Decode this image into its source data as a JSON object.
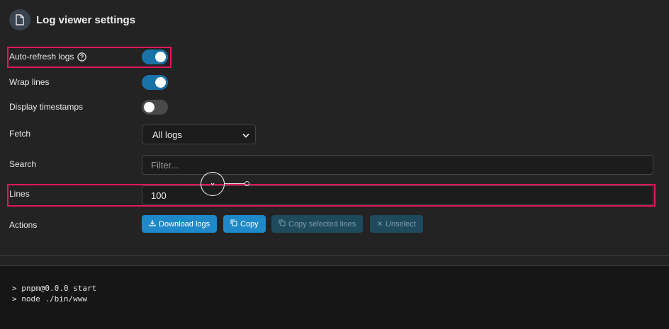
{
  "header": {
    "title": "Log viewer settings",
    "icon": "document-icon"
  },
  "settings": {
    "auto_refresh": {
      "label": "Auto-refresh logs",
      "enabled": true
    },
    "wrap_lines": {
      "label": "Wrap lines",
      "enabled": true
    },
    "display_timestamps": {
      "label": "Display timestamps",
      "enabled": false
    },
    "fetch": {
      "label": "Fetch",
      "selected": "All logs"
    },
    "search": {
      "label": "Search",
      "placeholder": "Filter...",
      "value": ""
    },
    "lines": {
      "label": "Lines",
      "value": "100"
    },
    "actions": {
      "label": "Actions",
      "download": "Download logs",
      "copy": "Copy",
      "copy_selected": "Copy selected lines",
      "unselect": "Unselect"
    }
  },
  "console": {
    "lines": [
      "> pnpm@0.0.0 start",
      "> node ./bin/www"
    ]
  },
  "colors": {
    "toggle_on": "#1a73a8",
    "primary_button": "#1e88c9",
    "disabled_button": "#1f4a5c",
    "highlight": "#e0165f"
  }
}
